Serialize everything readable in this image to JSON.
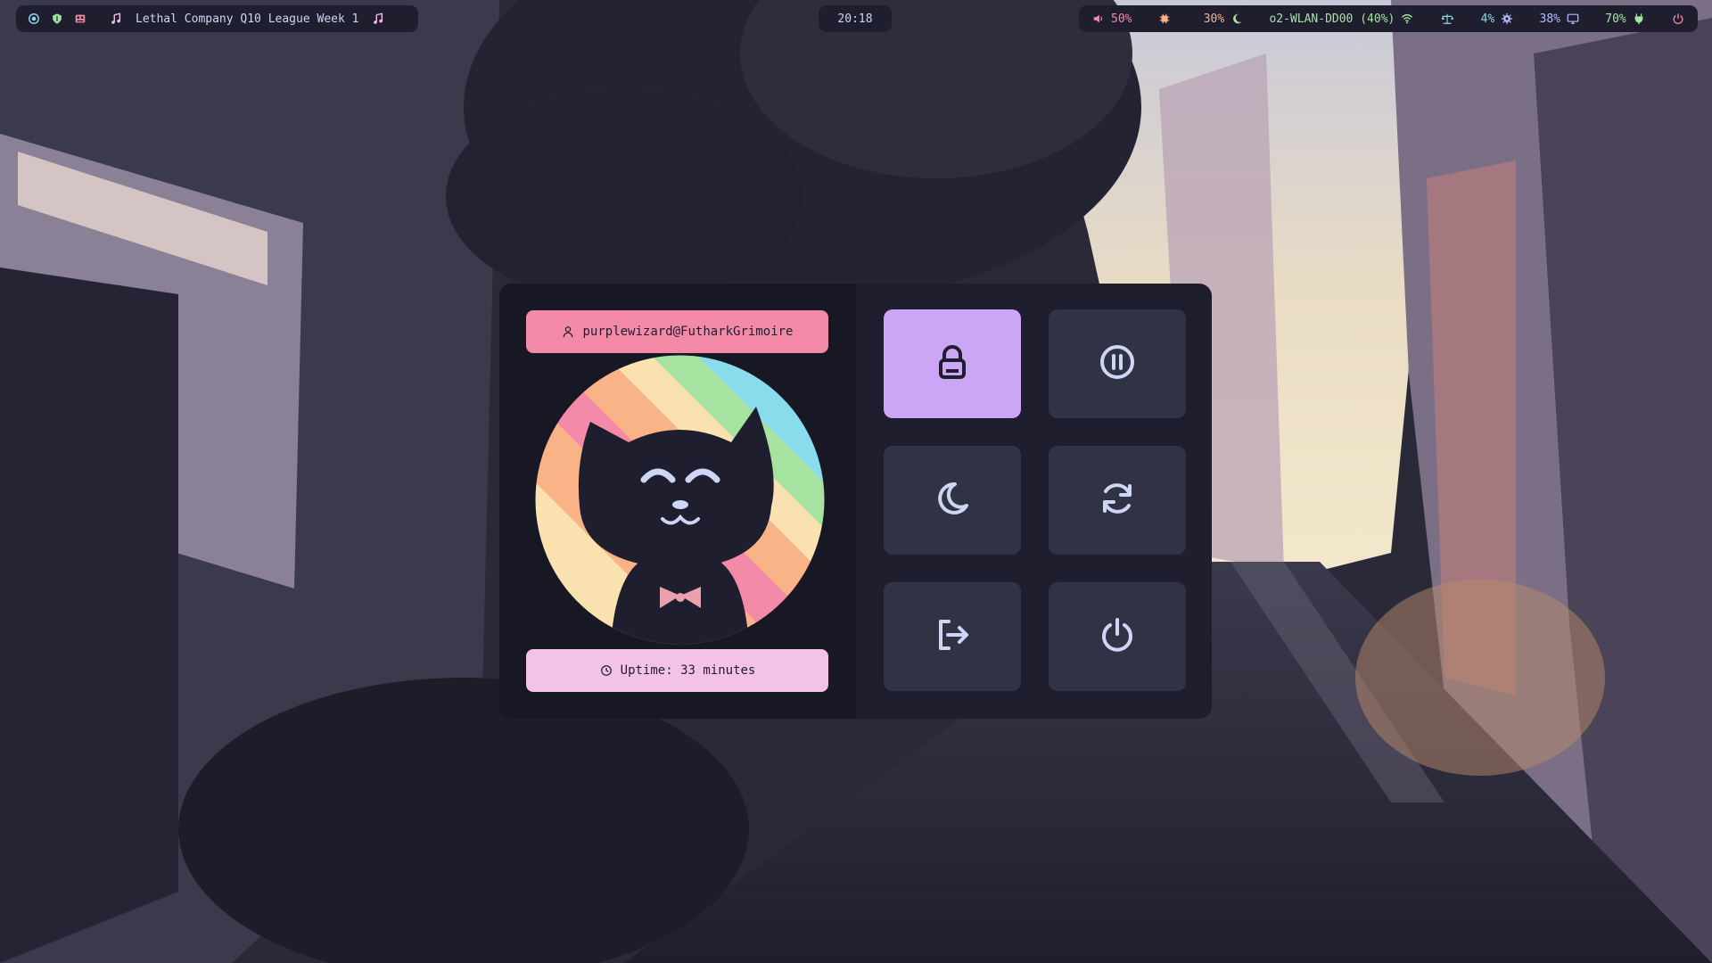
{
  "topbar": {
    "left": {
      "media_title": "Lethal Company Q10 League Week 1",
      "icons": [
        "radio-button-icon",
        "shield-icon",
        "game-app-icon",
        "music-note-icon",
        "music-note-icon"
      ]
    },
    "clock": "20:18",
    "right": {
      "volume": "50%",
      "cpu": "30%",
      "network": "o2-WLAN-DD00 (40%)",
      "load": "4%",
      "temp": "38%",
      "battery": "70%"
    }
  },
  "power_menu": {
    "user": "purplewizard@FutharkGrimoire",
    "uptime": "Uptime: 33 minutes",
    "buttons": [
      {
        "action": "lock",
        "icon": "lock-icon",
        "active": true
      },
      {
        "action": "suspend",
        "icon": "pause-icon",
        "active": false
      },
      {
        "action": "hibernate",
        "icon": "moon-icon",
        "active": false
      },
      {
        "action": "reboot",
        "icon": "refresh-icon",
        "active": false
      },
      {
        "action": "logout",
        "icon": "logout-icon",
        "active": false
      },
      {
        "action": "shutdown",
        "icon": "power-icon",
        "active": false
      }
    ]
  },
  "colors": {
    "bar_bg": "#1e1e2e",
    "menu_bg": "#1e1e2e",
    "button_bg": "#313244",
    "accent_active": "#cba6f7",
    "user_pill": "#f38ba8",
    "uptime_pill": "#f5c2e7",
    "icon_fg": "#cdd6f4"
  }
}
